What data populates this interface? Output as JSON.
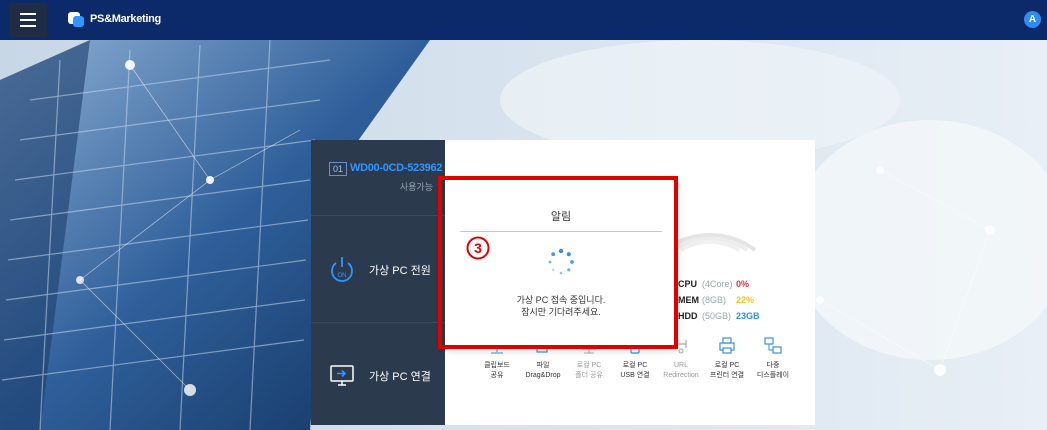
{
  "header": {
    "app_name": "PS&Marketing",
    "user_initial": "A"
  },
  "vm": {
    "number": "01",
    "name": "WD00-0CD-523962",
    "status": "사용가능"
  },
  "sidebar": {
    "power_label": "가상 PC 전원",
    "power_icon_text": "ON",
    "connect_label": "가상 PC 연결"
  },
  "resources": [
    {
      "key": "CPU",
      "spec": "(4Core)",
      "value": "0%",
      "color": "#e0323a"
    },
    {
      "key": "MEM",
      "spec": "(8GB)",
      "value": "22%",
      "color": "#f2c41a"
    },
    {
      "key": "HDD",
      "spec": "(50GB)",
      "value": "23GB",
      "color": "#2f8ee8"
    }
  ],
  "features": [
    {
      "line1": "클립보드",
      "line2": "공유",
      "icon": "clipboard-icon"
    },
    {
      "line1": "파일",
      "line2": "Drag&Drop",
      "icon": "file-drag-icon"
    },
    {
      "line1": "로컬 PC",
      "line2": "폴더 공유",
      "icon": "folder-share-icon",
      "muted": true
    },
    {
      "line1": "로컬 PC",
      "line2": "USB 연결",
      "icon": "usb-icon"
    },
    {
      "line1": "URL",
      "line2": "Redirection",
      "icon": "url-redirect-icon",
      "muted": true
    },
    {
      "line1": "로컬 PC",
      "line2": "프린터 연결",
      "icon": "printer-icon"
    },
    {
      "line1": "다중",
      "line2": "디스플레이",
      "icon": "multi-display-icon"
    }
  ],
  "dialog": {
    "title": "알림",
    "message_line1": "가상 PC 접속 중입니다.",
    "message_line2": "잠시만 기다려주세요.",
    "step_marker": "3"
  },
  "colors": {
    "topbar": "#0c2a6a",
    "accent": "#2f97ff",
    "highlight": "#e00000",
    "sidebar": "#2b3a4d"
  }
}
